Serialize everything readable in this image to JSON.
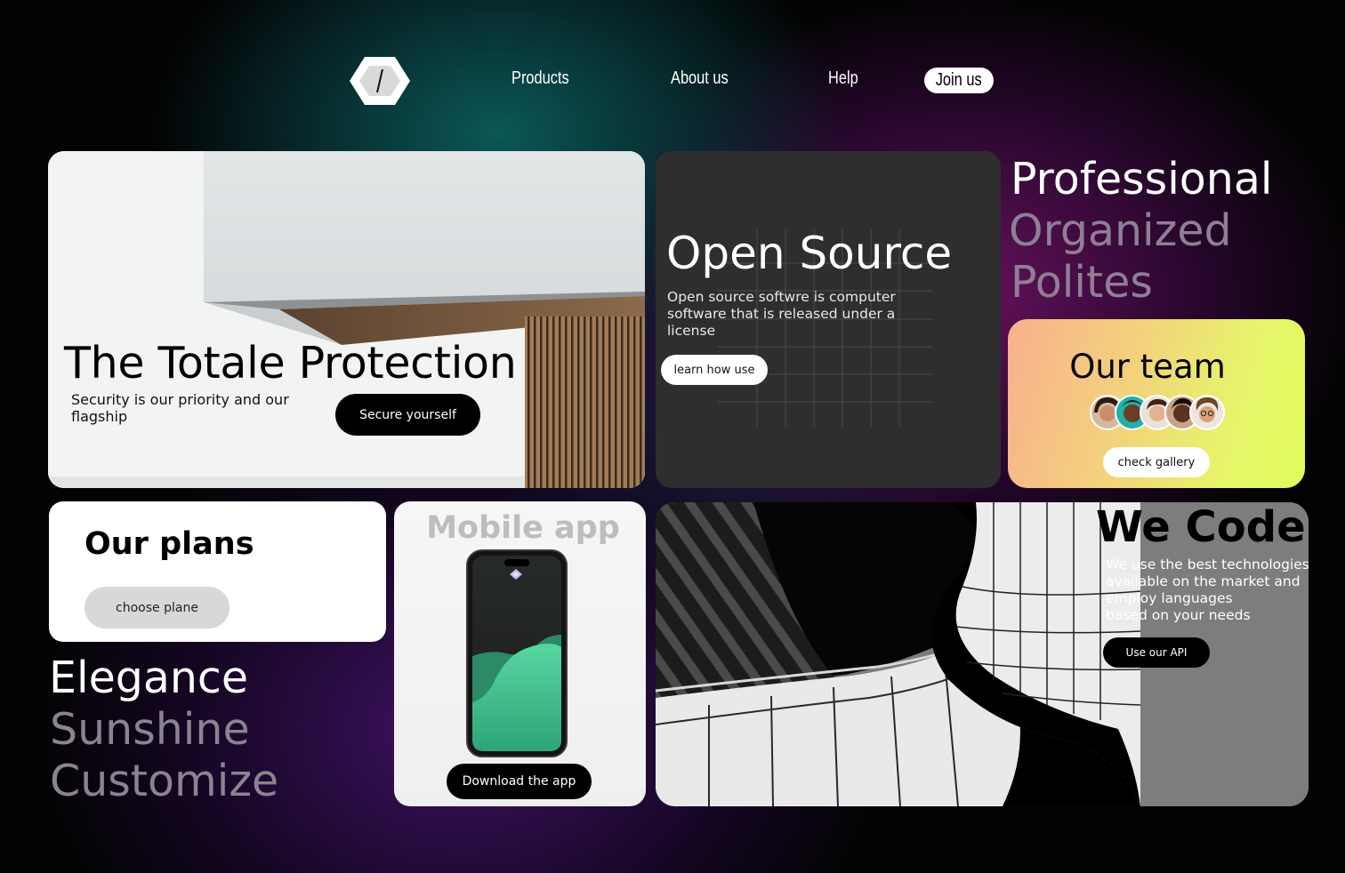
{
  "nav": {
    "links": [
      "Products",
      "About us",
      "Help"
    ],
    "join_label": "Join us",
    "logo_glyph": "/"
  },
  "protection": {
    "title": "The Totale Protection",
    "subtitle": "Security is our priority and our flagship",
    "button": "Secure yourself"
  },
  "open_source": {
    "title": "Open Source",
    "subtitle": "Open source softwre is computer software that is released under a license",
    "button": "learn how use"
  },
  "values_top": [
    "Professional",
    "Organized",
    "Polites"
  ],
  "team": {
    "title": "Our team",
    "button": "check gallery",
    "avatar_count": 5
  },
  "plans": {
    "title": "Our plans",
    "button": "choose plane"
  },
  "values_bottom": [
    "Elegance",
    "Sunshine",
    "Customize"
  ],
  "mobile": {
    "title": "Mobile app",
    "button": "Download the app"
  },
  "code": {
    "title": "We Code",
    "subtitle_lines": [
      "We use the best technologies",
      "available on the market and",
      "employ languages",
      "based on your needs"
    ],
    "button": "Use our API"
  },
  "colors": {
    "accent_green": "#3ecf8e",
    "muted_word": "#8a7f91",
    "team_gradient_start": "#f8b08e",
    "team_gradient_end": "#e1fb5c"
  }
}
